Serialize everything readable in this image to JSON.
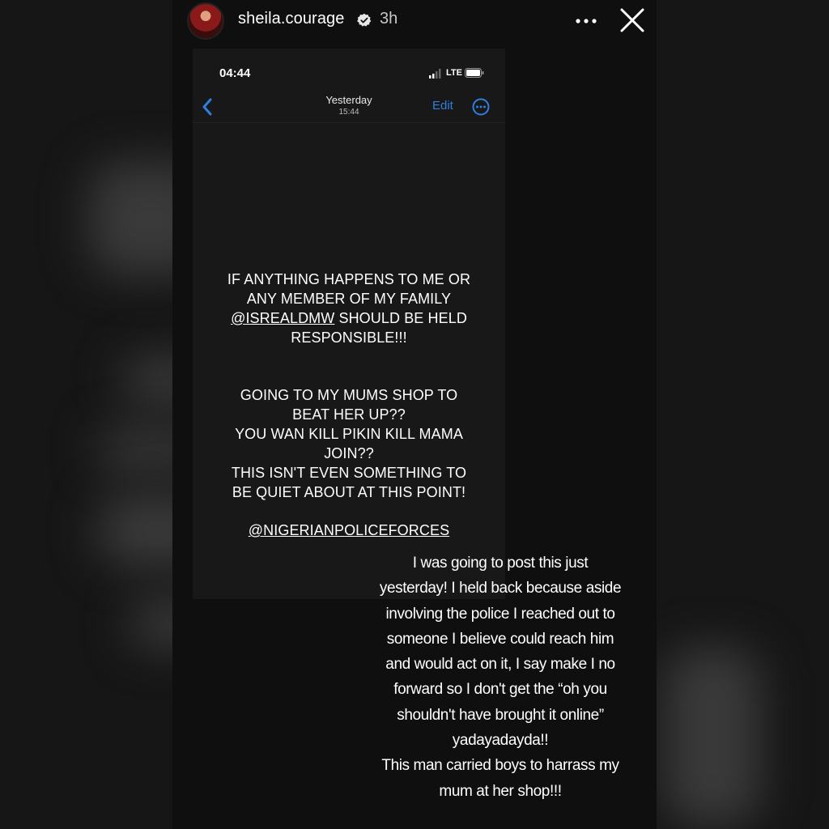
{
  "story": {
    "username": "sheila.courage",
    "verified": true,
    "time_ago": "3h",
    "more_icon": "more-horizontal-icon",
    "close_icon": "close-icon"
  },
  "screenshot": {
    "status_time": "04:44",
    "network": "LTE",
    "nav": {
      "title": "Yesterday",
      "subtitle": "15:44",
      "edit_label": "Edit"
    },
    "message": {
      "para1_line1": "IF ANYTHING HAPPENS TO ME OR",
      "para1_line2": "ANY MEMBER OF MY FAMILY",
      "para1_mention": "@ISREALDMW",
      "para1_line3_rest": " SHOULD BE HELD",
      "para1_line4": "RESPONSIBLE!!!",
      "para2_line1": "GOING TO MY MUMS SHOP TO",
      "para2_line2": "BEAT HER UP??",
      "para2_line3": "YOU WAN KILL PIKIN KILL MAMA",
      "para2_line4": "JOIN??",
      "para2_line5": "THIS ISN'T EVEN SOMETHING TO",
      "para2_line6": "BE QUIET ABOUT AT THIS POINT!",
      "mention2": "@NIGERIANPOLICEFORCES"
    }
  },
  "caption": {
    "line1": "I was going to post this just",
    "line2": "yesterday! I held back because aside",
    "line3": "involving the police I reached out to",
    "line4": "someone I believe could reach him",
    "line5": "and would act on it, I say make I no",
    "line6": "forward so I don't get the “oh you",
    "line7": "shouldn't have brought it online”",
    "line8": "yadayadayda!!",
    "line9": "This man carried boys to harrass my",
    "line10": "mum at her shop!!!"
  },
  "colors": {
    "background": "#161616",
    "link_blue": "#2f7fe0",
    "text": "#ffffff"
  }
}
